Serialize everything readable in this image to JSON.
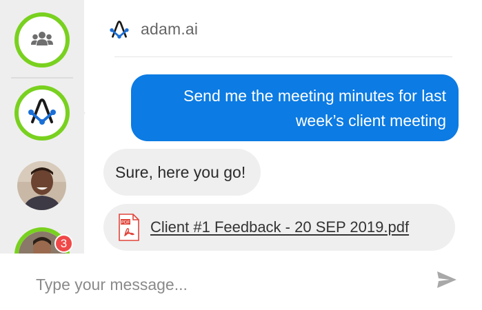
{
  "header": {
    "title": "adam.ai",
    "logo_icon": "adam-ai-logo-icon"
  },
  "sidebar": {
    "items": [
      {
        "icon": "group-icon",
        "active_ring": true
      },
      {
        "icon": "adam-ai-logo-icon",
        "active_ring": true,
        "selected": true
      },
      {
        "icon": "user-avatar",
        "active_ring": false
      },
      {
        "icon": "user-avatar",
        "active_ring": true,
        "badge": "3"
      }
    ]
  },
  "messages": [
    {
      "direction": "outgoing",
      "lines": [
        "Send me the meeting minutes for last",
        "week’s client meeting"
      ]
    },
    {
      "direction": "incoming",
      "text": "Sure, here you go!"
    },
    {
      "direction": "incoming",
      "type": "file",
      "file_icon": "pdf-file-icon",
      "file_label": "PDF",
      "file_name": "Client #1 Feedback - 20 SEP 2019.pdf"
    }
  ],
  "composer": {
    "placeholder": "Type your message...",
    "value": "",
    "send_icon": "send-icon"
  },
  "colors": {
    "accent_blue": "#0c7be3",
    "ring_green": "#79d11f",
    "badge_red": "#f04848",
    "rail_bg": "#eeeeee",
    "bubble_in_bg": "#efefef"
  }
}
